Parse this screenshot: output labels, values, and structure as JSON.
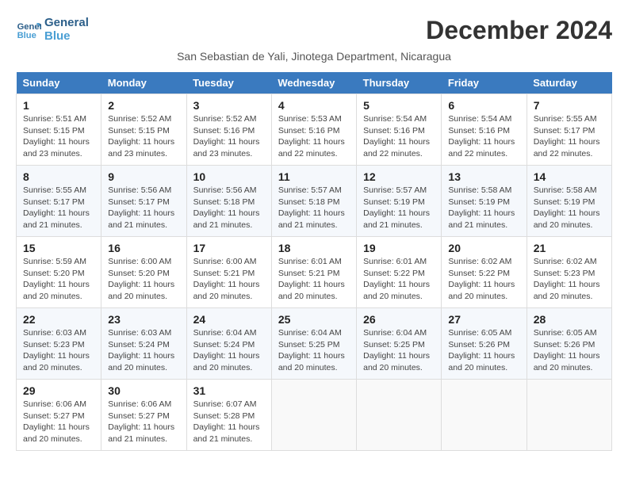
{
  "logo": {
    "line1": "General",
    "line2": "Blue"
  },
  "title": "December 2024",
  "subtitle": "San Sebastian de Yali, Jinotega Department, Nicaragua",
  "weekdays": [
    "Sunday",
    "Monday",
    "Tuesday",
    "Wednesday",
    "Thursday",
    "Friday",
    "Saturday"
  ],
  "weeks": [
    [
      {
        "day": "1",
        "sunrise": "5:51 AM",
        "sunset": "5:15 PM",
        "daylight": "11 hours and 23 minutes."
      },
      {
        "day": "2",
        "sunrise": "5:52 AM",
        "sunset": "5:15 PM",
        "daylight": "11 hours and 23 minutes."
      },
      {
        "day": "3",
        "sunrise": "5:52 AM",
        "sunset": "5:16 PM",
        "daylight": "11 hours and 23 minutes."
      },
      {
        "day": "4",
        "sunrise": "5:53 AM",
        "sunset": "5:16 PM",
        "daylight": "11 hours and 22 minutes."
      },
      {
        "day": "5",
        "sunrise": "5:54 AM",
        "sunset": "5:16 PM",
        "daylight": "11 hours and 22 minutes."
      },
      {
        "day": "6",
        "sunrise": "5:54 AM",
        "sunset": "5:16 PM",
        "daylight": "11 hours and 22 minutes."
      },
      {
        "day": "7",
        "sunrise": "5:55 AM",
        "sunset": "5:17 PM",
        "daylight": "11 hours and 22 minutes."
      }
    ],
    [
      {
        "day": "8",
        "sunrise": "5:55 AM",
        "sunset": "5:17 PM",
        "daylight": "11 hours and 21 minutes."
      },
      {
        "day": "9",
        "sunrise": "5:56 AM",
        "sunset": "5:17 PM",
        "daylight": "11 hours and 21 minutes."
      },
      {
        "day": "10",
        "sunrise": "5:56 AM",
        "sunset": "5:18 PM",
        "daylight": "11 hours and 21 minutes."
      },
      {
        "day": "11",
        "sunrise": "5:57 AM",
        "sunset": "5:18 PM",
        "daylight": "11 hours and 21 minutes."
      },
      {
        "day": "12",
        "sunrise": "5:57 AM",
        "sunset": "5:19 PM",
        "daylight": "11 hours and 21 minutes."
      },
      {
        "day": "13",
        "sunrise": "5:58 AM",
        "sunset": "5:19 PM",
        "daylight": "11 hours and 21 minutes."
      },
      {
        "day": "14",
        "sunrise": "5:58 AM",
        "sunset": "5:19 PM",
        "daylight": "11 hours and 20 minutes."
      }
    ],
    [
      {
        "day": "15",
        "sunrise": "5:59 AM",
        "sunset": "5:20 PM",
        "daylight": "11 hours and 20 minutes."
      },
      {
        "day": "16",
        "sunrise": "6:00 AM",
        "sunset": "5:20 PM",
        "daylight": "11 hours and 20 minutes."
      },
      {
        "day": "17",
        "sunrise": "6:00 AM",
        "sunset": "5:21 PM",
        "daylight": "11 hours and 20 minutes."
      },
      {
        "day": "18",
        "sunrise": "6:01 AM",
        "sunset": "5:21 PM",
        "daylight": "11 hours and 20 minutes."
      },
      {
        "day": "19",
        "sunrise": "6:01 AM",
        "sunset": "5:22 PM",
        "daylight": "11 hours and 20 minutes."
      },
      {
        "day": "20",
        "sunrise": "6:02 AM",
        "sunset": "5:22 PM",
        "daylight": "11 hours and 20 minutes."
      },
      {
        "day": "21",
        "sunrise": "6:02 AM",
        "sunset": "5:23 PM",
        "daylight": "11 hours and 20 minutes."
      }
    ],
    [
      {
        "day": "22",
        "sunrise": "6:03 AM",
        "sunset": "5:23 PM",
        "daylight": "11 hours and 20 minutes."
      },
      {
        "day": "23",
        "sunrise": "6:03 AM",
        "sunset": "5:24 PM",
        "daylight": "11 hours and 20 minutes."
      },
      {
        "day": "24",
        "sunrise": "6:04 AM",
        "sunset": "5:24 PM",
        "daylight": "11 hours and 20 minutes."
      },
      {
        "day": "25",
        "sunrise": "6:04 AM",
        "sunset": "5:25 PM",
        "daylight": "11 hours and 20 minutes."
      },
      {
        "day": "26",
        "sunrise": "6:04 AM",
        "sunset": "5:25 PM",
        "daylight": "11 hours and 20 minutes."
      },
      {
        "day": "27",
        "sunrise": "6:05 AM",
        "sunset": "5:26 PM",
        "daylight": "11 hours and 20 minutes."
      },
      {
        "day": "28",
        "sunrise": "6:05 AM",
        "sunset": "5:26 PM",
        "daylight": "11 hours and 20 minutes."
      }
    ],
    [
      {
        "day": "29",
        "sunrise": "6:06 AM",
        "sunset": "5:27 PM",
        "daylight": "11 hours and 20 minutes."
      },
      {
        "day": "30",
        "sunrise": "6:06 AM",
        "sunset": "5:27 PM",
        "daylight": "11 hours and 21 minutes."
      },
      {
        "day": "31",
        "sunrise": "6:07 AM",
        "sunset": "5:28 PM",
        "daylight": "11 hours and 21 minutes."
      },
      null,
      null,
      null,
      null
    ]
  ]
}
